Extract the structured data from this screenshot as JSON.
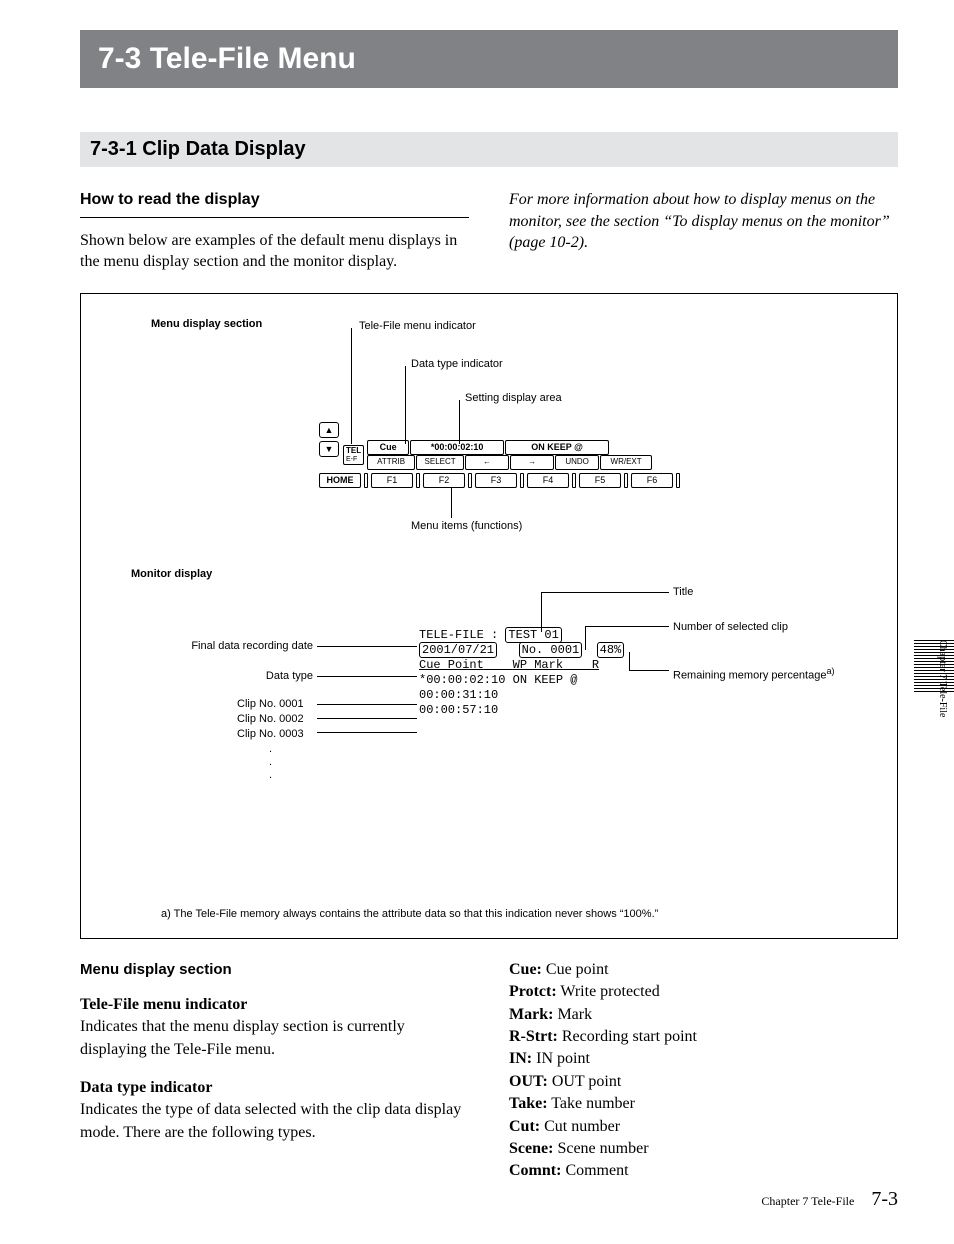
{
  "title_bar": "7-3  Tele-File Menu",
  "section_bar": "7-3-1  Clip Data Display",
  "left_col": {
    "heading": "How to read the display",
    "body": "Shown below are examples of the default menu displays in the menu display section and the monitor display."
  },
  "right_col": {
    "body": "For more information about how to display menus on the monitor, see the section “To display menus on the monitor” (page 10-2)."
  },
  "diagram": {
    "label_menu_display_section": "Menu display section",
    "label_telefile_indicator": "Tele-File menu indicator",
    "label_data_type_indicator": "Data type indicator",
    "label_setting_area": "Setting display area",
    "label_menu_items": "Menu items (functions)",
    "strip": {
      "tel": "TEL",
      "ef": "E-F",
      "cue": "Cue",
      "tc": "*00:00:02:10",
      "onkeep": "ON KEEP @",
      "attrib": "ATTRIB",
      "select": "SELECT",
      "left": "←",
      "right": "→",
      "undo": "UNDO",
      "wrext": "WR/EXT",
      "home": "HOME",
      "f1": "F1",
      "f2": "F2",
      "f3": "F3",
      "f4": "F4",
      "f5": "F5",
      "f6": "F6"
    },
    "label_monitor_display": "Monitor display",
    "label_final_date": "Final data recording date",
    "label_data_type": "Data type",
    "label_clip1": "Clip No. 0001",
    "label_clip2": "Clip No. 0002",
    "label_clip3": "Clip No. 0003",
    "label_dots": ".",
    "label_title": "Title",
    "label_num_clip": "Number of selected clip",
    "label_remaining": "Remaining memory percentage",
    "label_remaining_sup": "a)",
    "monitor": {
      "line1a": "TELE-FILE :",
      "line1b": "TEST 01",
      "line2a": "2001/07/21",
      "line2b": "No. 0001",
      "line2c": "48%",
      "line3a": "Cue Point",
      "line3b": "WP Mark",
      "line3c": "R",
      "line4": "*00:00:02:10   ON KEEP   @",
      "line5": " 00:00:31:10",
      "line6": " 00:00:57:10"
    },
    "footnote": "a) The Tele-File memory always contains the attribute data so that this indication never shows “100%.”"
  },
  "lower_left": {
    "heading": "Menu display section",
    "sub1_title": "Tele-File menu indicator",
    "sub1_body": "Indicates that the menu display section is currently displaying the Tele-File menu.",
    "sub2_title": "Data type indicator",
    "sub2_body": "Indicates the type of data selected with the clip data display mode. There are the following types."
  },
  "lower_right": {
    "items": [
      {
        "k": "Cue:",
        "v": " Cue point"
      },
      {
        "k": "Protct:",
        "v": " Write protected"
      },
      {
        "k": "Mark:",
        "v": " Mark"
      },
      {
        "k": "R-Strt:",
        "v": " Recording start point"
      },
      {
        "k": "IN:",
        "v": " IN point"
      },
      {
        "k": "OUT:",
        "v": " OUT point"
      },
      {
        "k": "Take:",
        "v": " Take number"
      },
      {
        "k": "Cut:",
        "v": " Cut number"
      },
      {
        "k": "Scene:",
        "v": " Scene number"
      },
      {
        "k": "Comnt:",
        "v": " Comment"
      }
    ]
  },
  "footer": {
    "chapter": "Chapter 7   Tele-File",
    "page": "7-3"
  },
  "side_tab": "Chapter 7   Tele-File"
}
